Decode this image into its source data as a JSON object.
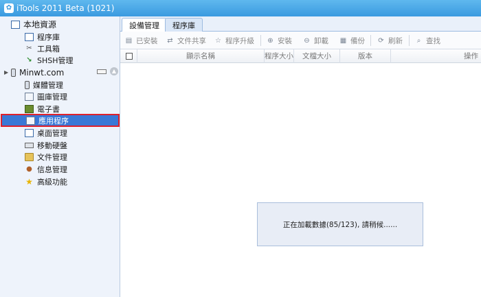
{
  "window": {
    "title": "iTools 2011 Beta (1021)",
    "app_icon": "iTools-logo-icon"
  },
  "sidebar": {
    "local_root": {
      "label": "本地資源",
      "icon": "computer-icon"
    },
    "local_items": [
      {
        "label": "程序庫",
        "icon": "app-library-icon"
      },
      {
        "label": "工具箱",
        "icon": "tools-icon"
      },
      {
        "label": "SHSH管理",
        "icon": "shsh-icon"
      }
    ],
    "device_root": {
      "label": "Minwt.com",
      "icon": "iphone-icon"
    },
    "device_items": [
      {
        "label": "媒體管理",
        "icon": "media-icon"
      },
      {
        "label": "圖庫管理",
        "icon": "photo-icon"
      },
      {
        "label": "電子書",
        "icon": "ebook-icon"
      },
      {
        "label": "應用程序",
        "icon": "applications-icon",
        "selected": true
      },
      {
        "label": "桌面管理",
        "icon": "desktop-icon"
      },
      {
        "label": "移動硬盤",
        "icon": "drive-icon"
      },
      {
        "label": "文件管理",
        "icon": "folder-icon"
      },
      {
        "label": "信息管理",
        "icon": "contacts-icon"
      },
      {
        "label": "高級功能",
        "icon": "star-icon"
      }
    ]
  },
  "tabs": [
    {
      "label": "設備管理",
      "active": true
    },
    {
      "label": "程序庫",
      "active": false
    }
  ],
  "toolbar": {
    "installed": "已安裝",
    "file_share": "文件共享",
    "upgrade": "程序升級",
    "install": "安裝",
    "uninstall": "卸載",
    "backup": "備份",
    "refresh": "刷新",
    "search": "查找"
  },
  "table": {
    "columns": [
      "顯示名稱",
      "程序大小",
      "文檔大小",
      "版本",
      "操作"
    ]
  },
  "loading": {
    "message": "正在加載數據(85/123), 請稍候......"
  },
  "colors": {
    "titlebar": "#3a9ae0",
    "selection": "#3a78d6",
    "highlight_border": "#e0202a"
  }
}
